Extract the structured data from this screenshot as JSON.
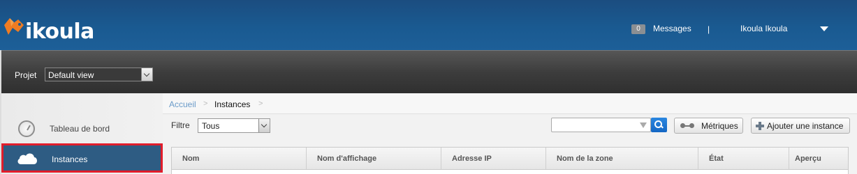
{
  "header": {
    "brand": "ikoula",
    "messages_count": "0",
    "messages_label": "Messages",
    "separator": "|",
    "user_name": "Ikoula Ikoula"
  },
  "project": {
    "label": "Projet",
    "selected": "Default view"
  },
  "sidebar": {
    "items": [
      {
        "label": "Tableau de bord",
        "icon": "gauge-icon",
        "active": false
      },
      {
        "label": "Instances",
        "icon": "cloud-icon",
        "active": true
      }
    ]
  },
  "breadcrumb": {
    "home": "Accueil",
    "current": "Instances",
    "sep": ">"
  },
  "toolbar": {
    "filter_label": "Filtre",
    "filter_value": "Tous",
    "search_value": "",
    "metrics_label": "Métriques",
    "add_label": "Ajouter une instance"
  },
  "table": {
    "columns": [
      "Nom",
      "Nom d'affichage",
      "Adresse IP",
      "Nom de la zone",
      "État",
      "Aperçu"
    ]
  },
  "colors": {
    "header_blue": "#1a5a91",
    "active_item": "#2e5c83",
    "highlight_border": "#e11d2b",
    "link": "#6a9bc9"
  }
}
